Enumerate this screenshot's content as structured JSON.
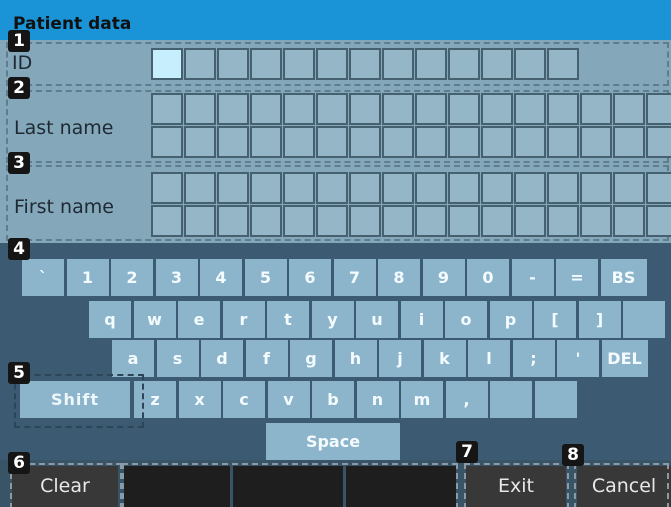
{
  "title": "Patient data",
  "badges": [
    "1",
    "2",
    "3",
    "4",
    "5",
    "6",
    "7",
    "8"
  ],
  "fields": {
    "id_label": "ID",
    "last_name_label": "Last name",
    "first_name_label": "First name"
  },
  "keyboard": {
    "row1": [
      "`",
      "1",
      "2",
      "3",
      "4",
      "5",
      "6",
      "7",
      "8",
      "9",
      "0",
      "-",
      "=",
      "BS"
    ],
    "row2": [
      "q",
      "w",
      "e",
      "r",
      "t",
      "y",
      "u",
      "i",
      "o",
      "p",
      "[",
      "]",
      ""
    ],
    "row3": [
      "a",
      "s",
      "d",
      "f",
      "g",
      "h",
      "j",
      "k",
      "l",
      ";",
      "'",
      "DEL"
    ],
    "row4": [
      "Shift",
      "z",
      "x",
      "c",
      "v",
      "b",
      "n",
      "m",
      ",",
      "",
      ""
    ],
    "space": "Space"
  },
  "bottom": {
    "clear": "Clear",
    "exit": "Exit",
    "cancel": "Cancel"
  }
}
